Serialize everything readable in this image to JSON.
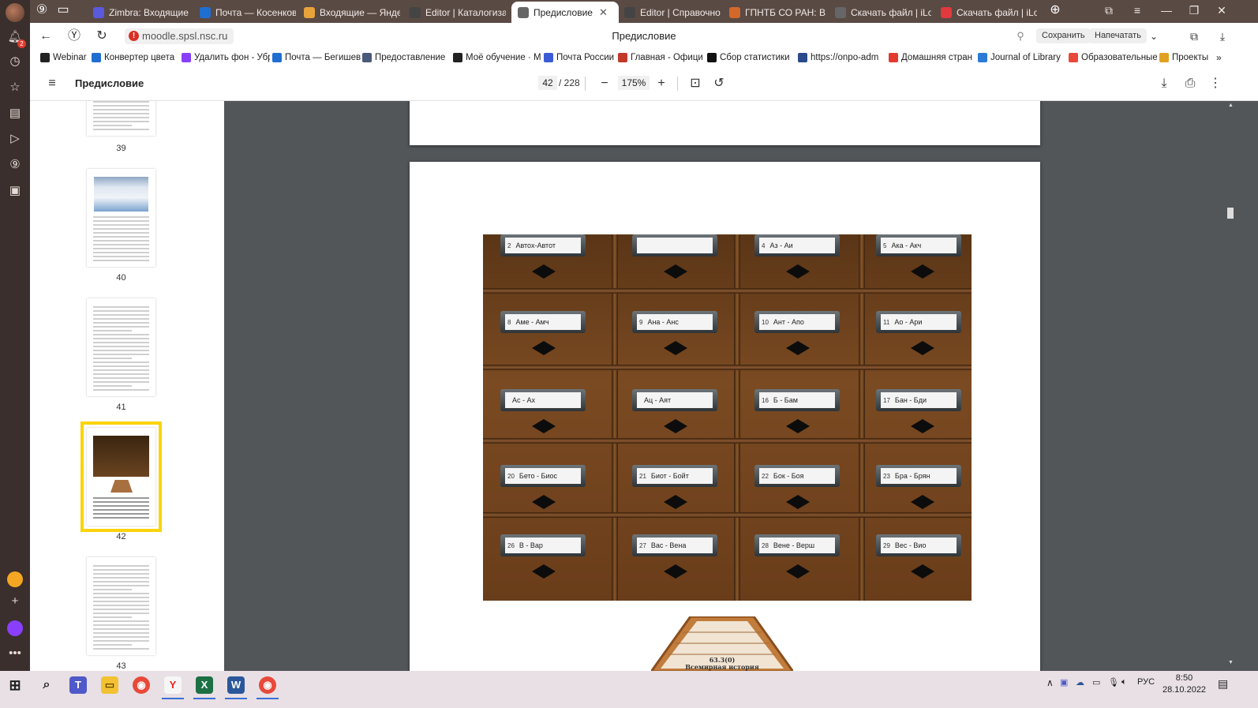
{
  "browser": {
    "tabs": [
      {
        "title": "Zimbra: Входящие (",
        "fav": "#5a5adc",
        "active": false
      },
      {
        "title": "Почта — Косенкова",
        "fav": "#1f6fd1",
        "active": false
      },
      {
        "title": "Входящие — Яндекс",
        "fav": "#e8a33b",
        "active": false
      },
      {
        "title": "Editor | Каталогиза",
        "fav": "#444444",
        "active": false
      },
      {
        "title": "Предисловие",
        "fav": "#666666",
        "active": true
      },
      {
        "title": "Editor | Справочно",
        "fav": "#444444",
        "active": false
      },
      {
        "title": "ГПНТБ СО РАН: Все",
        "fav": "#d2692a",
        "active": false
      },
      {
        "title": "Скачать файл | iLove",
        "fav": "#666666",
        "active": false
      },
      {
        "title": "Скачать файл | iLove",
        "fav": "#e0393e",
        "active": false
      }
    ],
    "tab_close": "✕",
    "url": "moodle.spsl.nsc.ru",
    "page_heading": "Предисловие",
    "save_label": "Сохранить",
    "print_label": "Напечатать",
    "bookmarks": [
      "Webinar",
      "Конвертер цвета",
      "Удалить фон - Убр",
      "Почта — Бегишев",
      "Предоставление",
      "Моё обучение · М",
      "Почта России",
      "Главная - Офици",
      "Сбор статистики",
      "https://onpo-adm",
      "Домашняя стран",
      "Journal of Library",
      "Образовательные",
      "Проекты"
    ],
    "sidebar_badge": "2"
  },
  "pdf": {
    "title": "Предисловие",
    "current_page": "42",
    "total_pages": "/ 228",
    "zoom": "175%",
    "thumbnails": [
      {
        "num": "39"
      },
      {
        "num": "40"
      },
      {
        "num": "41"
      },
      {
        "num": "42"
      },
      {
        "num": "43"
      }
    ]
  },
  "photo": {
    "drawers": [
      {
        "num": "2",
        "text": "Автох-Автот"
      },
      {
        "num": "",
        "text": ""
      },
      {
        "num": "4",
        "text": "Аз - Аи"
      },
      {
        "num": "5",
        "text": "Ака - Акч"
      },
      {
        "num": "8",
        "text": "Аме - Амч"
      },
      {
        "num": "9",
        "text": "Ана - Анс"
      },
      {
        "num": "10",
        "text": "Ант - Апо"
      },
      {
        "num": "11",
        "text": "Ао - Ари"
      },
      {
        "num": "",
        "text": "Ас - Ах"
      },
      {
        "num": "",
        "text": "Ац - Аят"
      },
      {
        "num": "16",
        "text": "Б - Бам"
      },
      {
        "num": "17",
        "text": "Бан - Бди"
      },
      {
        "num": "20",
        "text": "Бето - Биос"
      },
      {
        "num": "21",
        "text": "Биот - Бойт"
      },
      {
        "num": "22",
        "text": "Бок - Боя"
      },
      {
        "num": "23",
        "text": "Бра - Брян"
      },
      {
        "num": "26",
        "text": "В - Вар"
      },
      {
        "num": "27",
        "text": "Вас - Вена"
      },
      {
        "num": "28",
        "text": "Вене - Верш"
      },
      {
        "num": "29",
        "text": "Вес - Вио"
      }
    ],
    "box_cards": [
      "63.3(0)",
      "Всемирная история"
    ]
  },
  "taskbar": {
    "lang": "РУС",
    "time": "8:50",
    "date": "28.10.2022"
  }
}
